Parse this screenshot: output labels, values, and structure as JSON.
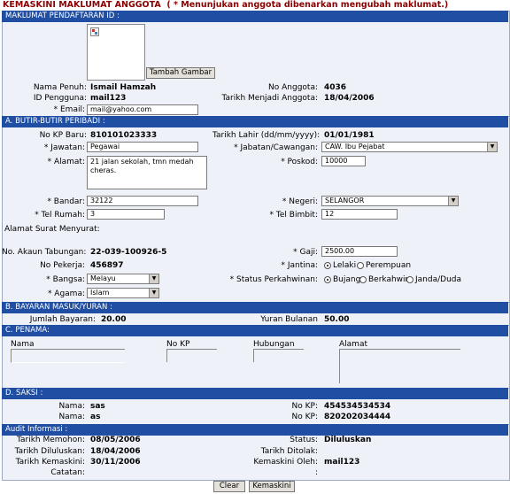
{
  "title": "KEMASKINI MAKLUMAT ANGGOTA",
  "title_note": "( * Menunjukan anggota dibenarkan mengubah maklumat.)",
  "sections": {
    "registration": "MAKLUMAT PENDAFTARAN ID :",
    "personal": "A. BUTIR-BUTIR PERIBADI :",
    "payment": "B. BAYARAN MASUK/YURAN :",
    "nominee": "C. PENAMA:",
    "witness": "D. SAKSI :",
    "audit": "Audit Informasi :"
  },
  "registration": {
    "add_image_button": "Tambah Gambar",
    "nama_penuh_label": "Nama Penuh:",
    "nama_penuh": "Ismail Hamzah",
    "no_anggota_label": "No Anggota:",
    "no_anggota": "4036",
    "id_pengguna_label": "ID Pengguna:",
    "id_pengguna": "mail123",
    "tarikh_menjadi_label": "Tarikh Menjadi Anggota:",
    "tarikh_menjadi": "18/04/2006",
    "email_label": "* Email:",
    "email": "mail@yahoo.com"
  },
  "personal": {
    "no_kp_label": "No KP Baru:",
    "no_kp": "810101023333",
    "tarikh_lahir_label": "Tarikh Lahir (dd/mm/yyyy):",
    "tarikh_lahir": "01/01/1981",
    "jawatan_label": "* Jawatan:",
    "jawatan": "Pegawai",
    "jabatan_label": "* Jabatan/Cawangan:",
    "jabatan": "CAW. Ibu Pejabat",
    "alamat_label": "* Alamat:",
    "alamat": "21 jalan sekolah, tmn medah cheras.",
    "poskod_label": "* Poskod:",
    "poskod": "10000",
    "bandar_label": "* Bandar:",
    "bandar": "32122",
    "negeri_label": "* Negeri:",
    "negeri": "SELANGOR",
    "tel_rumah_label": "* Tel Rumah:",
    "tel_rumah": "3",
    "tel_bimbit_label": "* Tel Bimbit:",
    "tel_bimbit": "12",
    "alamat_surat_label": "Alamat Surat Menyurat:",
    "akaun_label": "No. Akaun Tabungan:",
    "akaun": "22-039-100926-5",
    "gaji_label": "* Gaji:",
    "gaji": "2500.00",
    "no_pekerja_label": "No Pekerja:",
    "no_pekerja": "456897",
    "jantina_label": "* Jantina:",
    "jantina_options": [
      "Lelaki",
      "Perempuan"
    ],
    "bangsa_label": "* Bangsa:",
    "bangsa": "Melayu",
    "status_label": "* Status Perkahwinan:",
    "status_options": [
      "Bujang",
      "Berkahwin",
      "Janda/Duda"
    ],
    "agama_label": "* Agama:",
    "agama": "Islam"
  },
  "payment": {
    "jumlah_label": "Jumlah Bayaran:",
    "jumlah": "20.00",
    "yuran_label": "Yuran Bulanan",
    "yuran": "50.00"
  },
  "nominee": {
    "columns": [
      "Nama",
      "No KP",
      "Hubungan",
      "Alamat"
    ]
  },
  "witness": {
    "nama_label": "Nama:",
    "nokp_label": "No KP:",
    "rows": [
      {
        "nama": "sas",
        "nokp": "454534534534"
      },
      {
        "nama": "as",
        "nokp": "820202034444"
      }
    ]
  },
  "audit": {
    "memohon_label": "Tarikh Memohon:",
    "memohon": "08/05/2006",
    "status_label": "Status:",
    "status": "Diluluskan",
    "diluluskan_label": "Tarikh Diluluskan:",
    "diluluskan": "18/04/2006",
    "ditolak_label": "Tarikh Ditolak:",
    "kemaskini_label": "Tarikh Kemaskini:",
    "kemaskini": "30/11/2006",
    "kemaskini_oleh_label": "Kemaskini Oleh:",
    "kemaskini_oleh": "mail123",
    "catatan_label": "Catatan:",
    "colon": ":"
  },
  "actions": {
    "clear": "Clear",
    "update": "Kemaskini"
  }
}
